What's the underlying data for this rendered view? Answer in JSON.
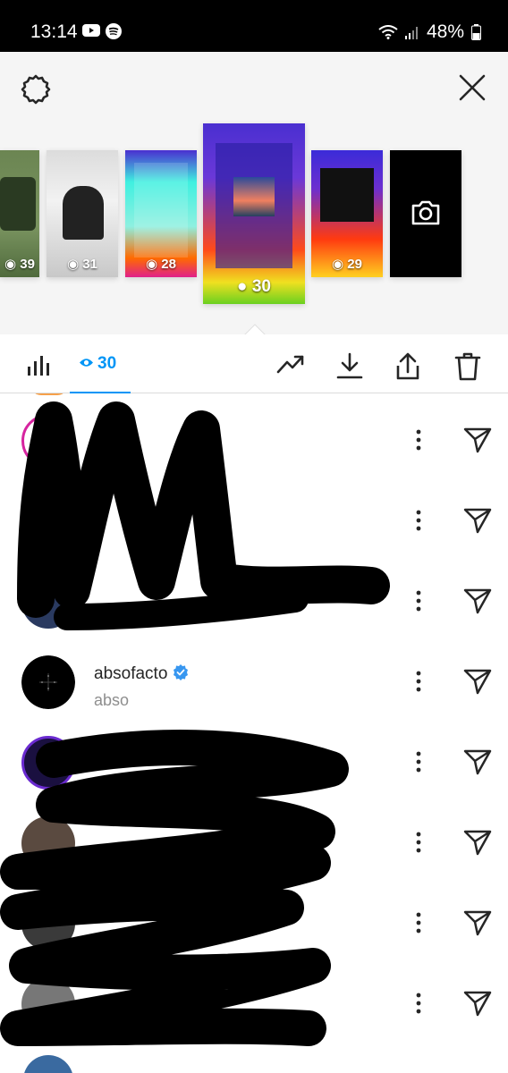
{
  "status_bar": {
    "time": "13:14",
    "battery": "48%"
  },
  "stories": [
    {
      "views": "39"
    },
    {
      "views": "31"
    },
    {
      "views": "28"
    },
    {
      "views": "30",
      "selected": true
    },
    {
      "views": "29"
    },
    {
      "type": "camera"
    }
  ],
  "tabs": {
    "viewers_count": "30"
  },
  "viewers": [
    {
      "username": "",
      "subtitle": ""
    },
    {
      "username": "",
      "subtitle": ""
    },
    {
      "username": "",
      "subtitle": ""
    },
    {
      "username": "absofacto",
      "subtitle": "abso",
      "verified": true
    },
    {
      "username": "",
      "subtitle": ""
    },
    {
      "username": "",
      "subtitle": ""
    },
    {
      "username": "",
      "subtitle": ""
    },
    {
      "username": "",
      "subtitle": ""
    }
  ],
  "colors": {
    "accent": "#0095f6",
    "verified": "#3897f0"
  }
}
